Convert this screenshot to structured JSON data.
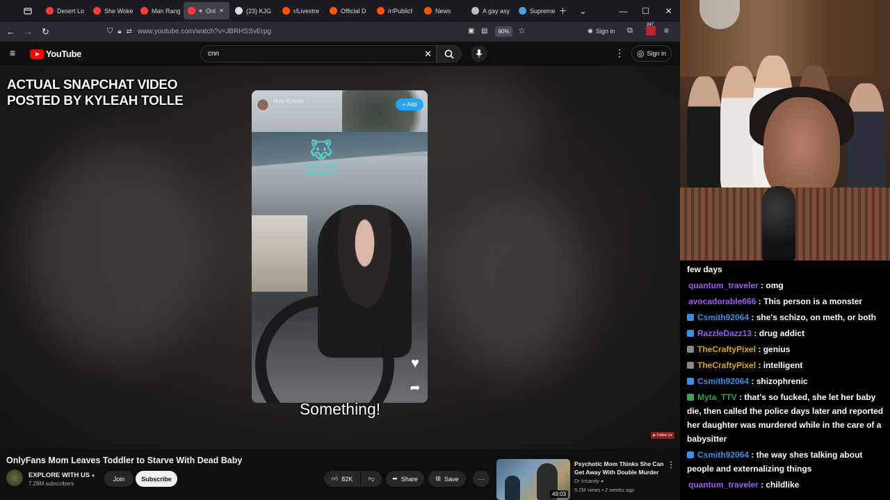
{
  "browser": {
    "tabs": [
      {
        "label": "Desert Lo",
        "color": "#ff3b3b"
      },
      {
        "label": "She Woke",
        "color": "#ff3b3b"
      },
      {
        "label": "Man Rang",
        "color": "#ff3b3b"
      },
      {
        "label": "Onl",
        "color": "#ff3b3b",
        "active": true
      },
      {
        "label": "(23) KJG",
        "color": "#dddddd"
      },
      {
        "label": "r/Livestre",
        "color": "#ff5700"
      },
      {
        "label": "Official D",
        "color": "#ff5700"
      },
      {
        "label": "/r/Publicf",
        "color": "#ff5700"
      },
      {
        "label": "News",
        "color": "#ff5700"
      },
      {
        "label": "A gay asy",
        "color": "#bbbbbb"
      },
      {
        "label": "Supreme",
        "color": "#4f9de8"
      }
    ],
    "url": "www.youtube.com/watch?v=JBRHSSvErpg",
    "zoom": "90%",
    "signin": "Sign in",
    "badge_count": "247"
  },
  "youtube": {
    "brand": "YouTube",
    "search_value": "cnn",
    "signin": "Sign in"
  },
  "video": {
    "overlay_title_1": "ACTUAL SNAPCHAT VIDEO",
    "overlay_title_2": "POSTED BY KYLEAH TOLLE",
    "snap_name": "Miss Kyleah",
    "snap_add": "Add",
    "watermark": "EXPLORE WITH US",
    "subtitle": "Something!",
    "title": "OnlyFans Mom Leaves Toddler to Starve With Dead Baby",
    "channel": "EXPLORE WITH US",
    "subscribers": "7.28M subscribers",
    "join": "Join",
    "subscribe": "Subscribe",
    "likes": "82K",
    "share": "Share",
    "save": "Save",
    "more": "···"
  },
  "recommended": {
    "title": "Psychotic Mom Thinks She Can Get Away With Double Murder",
    "channel": "Dr Insanity",
    "meta": "5.2M views • 2 weeks ago",
    "duration": "49:03"
  },
  "chat": [
    {
      "user": "",
      "text": "few days",
      "color": "#ffffff",
      "badge": ""
    },
    {
      "user": "quantum_traveler",
      "text": "omg",
      "color": "#9a5cf0",
      "badge": ""
    },
    {
      "user": "avocadorable666",
      "text": "This person is a monster",
      "color": "#9a5cf0",
      "badge": ""
    },
    {
      "user": "Csmith92064",
      "text": "she's schizo, on meth, or both",
      "color": "#3d8fe6",
      "badge": "#3d8fe6"
    },
    {
      "user": "RazzleDazz13",
      "text": "drug addict",
      "color": "#9a5cf0",
      "badge": "#3d8fe6"
    },
    {
      "user": "TheCraftyPixel",
      "text": "genius",
      "color": "#daa520",
      "badge": "#888888"
    },
    {
      "user": "TheCraftyPixel",
      "text": "intelligent",
      "color": "#daa520",
      "badge": "#888888"
    },
    {
      "user": "Csmith92064",
      "text": "shizophrenic",
      "color": "#3d8fe6",
      "badge": "#3d8fe6"
    },
    {
      "user": "Myta_TTV",
      "text": "that's so fucked, she let her baby die, then called the police days later and reported her daughter was murdered while in the care of a babysitter",
      "color": "#2e9e57",
      "badge": "#3da34a"
    },
    {
      "user": "Csmith92064",
      "text": "the way shes talking about people and externalizing things",
      "color": "#3d8fe6",
      "badge": "#3d8fe6"
    },
    {
      "user": "quantum_traveler",
      "text": "childlike",
      "color": "#9a5cf0",
      "badge": ""
    }
  ]
}
